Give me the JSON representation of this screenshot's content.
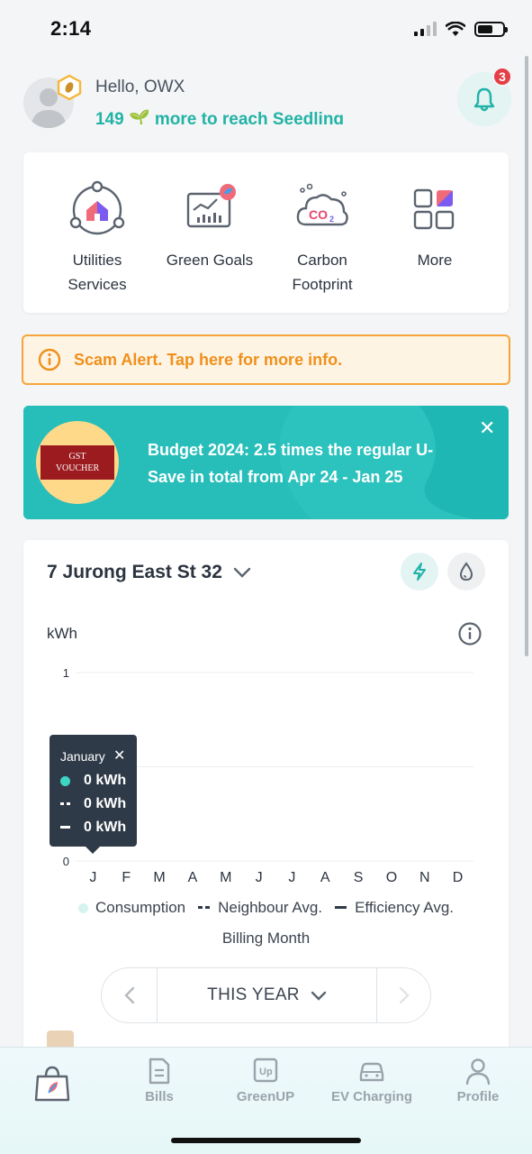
{
  "status_bar": {
    "time": "2:14"
  },
  "header": {
    "greeting": "Hello, OWX",
    "level_progress": "149 🌱 more to reach Seedling",
    "notification_count": "3"
  },
  "quick_actions": [
    {
      "label": "Utilities Services",
      "icon": "home-utilities-icon"
    },
    {
      "label": "Green Goals",
      "icon": "chart-goals-icon"
    },
    {
      "label": "Carbon Footprint",
      "icon": "co2-cloud-icon"
    },
    {
      "label": "More",
      "icon": "grid-more-icon"
    }
  ],
  "scam_alert": {
    "text": "Scam Alert. Tap here for more info."
  },
  "banner": {
    "text": "Budget 2024: 2.5 times the regular U-Save in total from Apr 24 - Jan 25",
    "voucher_line1": "GST",
    "voucher_line2": "VOUCHER",
    "close": "✕"
  },
  "usage": {
    "address": "7 Jurong East St 32",
    "unit": "kWh",
    "x_axis_title": "Billing Month",
    "period": "THIS YEAR",
    "legend": {
      "consumption": "Consumption",
      "neighbour": "Neighbour Avg.",
      "efficiency": "Efficiency Avg."
    },
    "tooltip": {
      "month": "January",
      "consumption": "0 kWh",
      "neighbour": "0 kWh",
      "efficiency": "0 kWh"
    }
  },
  "chart_data": {
    "type": "bar",
    "categories": [
      "J",
      "F",
      "M",
      "A",
      "M",
      "J",
      "J",
      "A",
      "S",
      "O",
      "N",
      "D"
    ],
    "series": [
      {
        "name": "Consumption",
        "values": [
          0,
          0,
          0,
          0,
          0,
          0,
          0,
          0,
          0,
          0,
          0,
          0
        ]
      },
      {
        "name": "Neighbour Avg.",
        "values": [
          0,
          0,
          0,
          0,
          0,
          0,
          0,
          0,
          0,
          0,
          0,
          0
        ]
      },
      {
        "name": "Efficiency Avg.",
        "values": [
          0,
          0,
          0,
          0,
          0,
          0,
          0,
          0,
          0,
          0,
          0,
          0
        ]
      }
    ],
    "yticks": [
      "0",
      "0.5",
      "1"
    ],
    "ylim": [
      0,
      1
    ],
    "xlabel": "Billing Month",
    "ylabel": "kWh",
    "grid": true,
    "legend_position": "bottom",
    "colors": {
      "consumption": "#3dd6c2",
      "neighbour": "#2f3a48",
      "efficiency": "#2f3a48"
    }
  },
  "tabbar": {
    "bills": "Bills",
    "greenup": "GreenUP",
    "ev": "EV Charging",
    "profile": "Profile"
  },
  "colors": {
    "accent": "#22b3a6",
    "alert": "#f0901c",
    "badge": "#e53e46"
  }
}
